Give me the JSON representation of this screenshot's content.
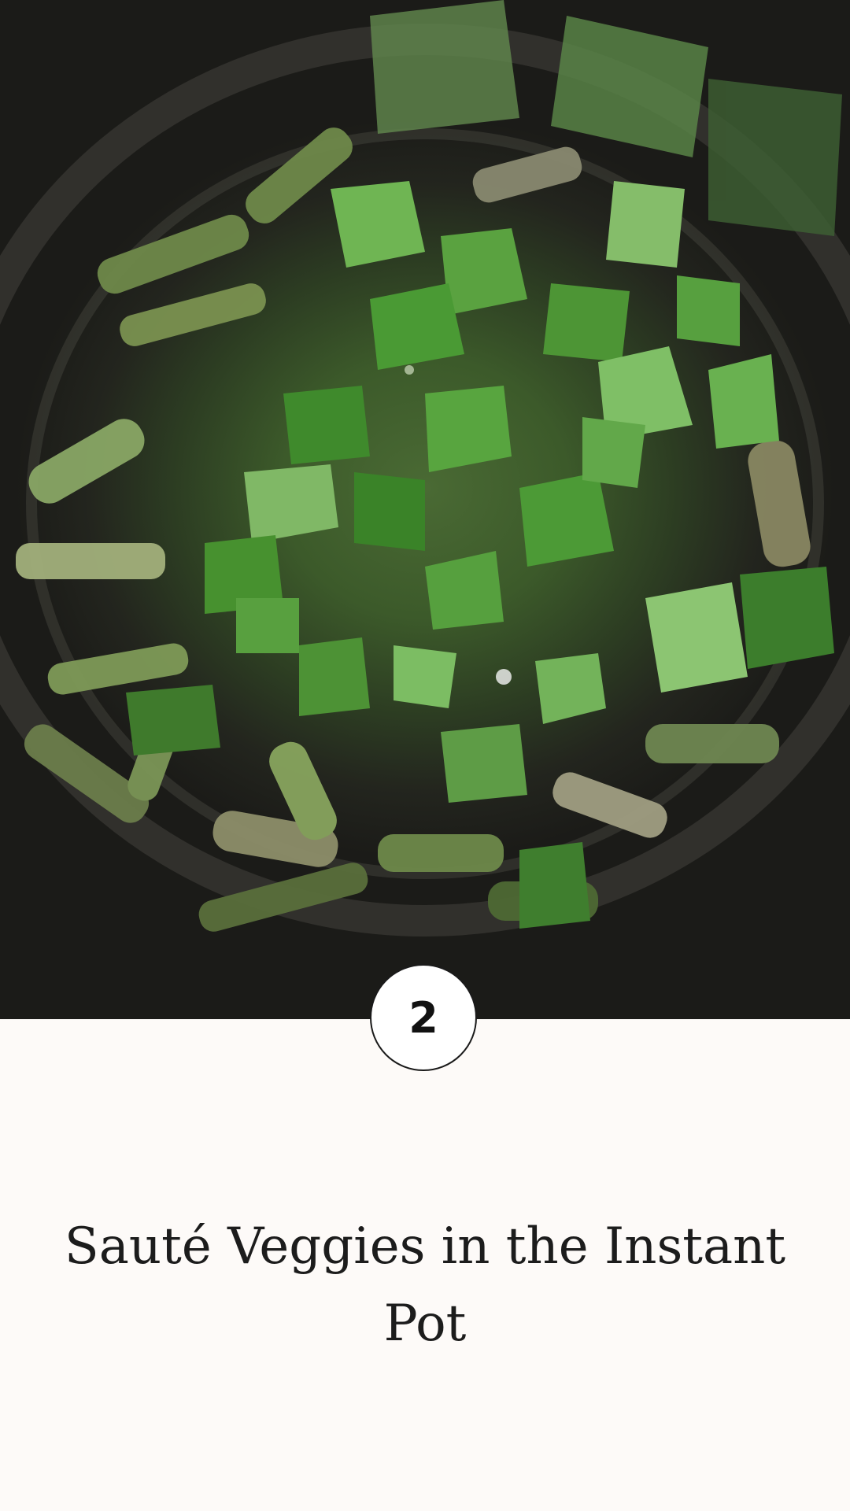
{
  "photo": {
    "alt": "Chopped asparagus and snow peas in the Instant Pot",
    "icon": "food-photo"
  },
  "step": {
    "number": "2"
  },
  "caption": {
    "title": "Sauté Veggies in the Instant Pot"
  },
  "colors": {
    "background": "#fdfaf8",
    "badge_border": "#1a1a1a",
    "text": "#1c1c1c"
  }
}
